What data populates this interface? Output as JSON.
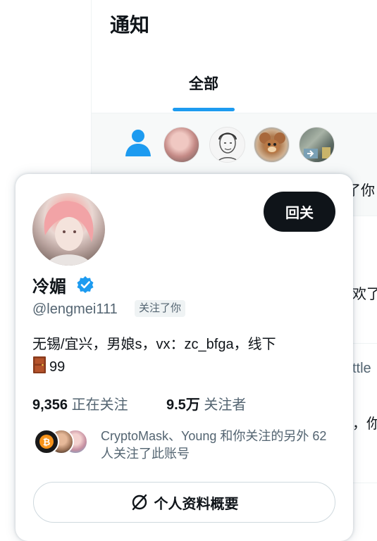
{
  "header": {
    "title": "通知"
  },
  "tabs": [
    {
      "label": "全部",
      "active": true
    }
  ],
  "notification": {
    "icon": "person-icon",
    "avatars": [
      "avatar-pink-hair",
      "avatar-sketch-man",
      "avatar-jerry-mouse",
      "avatar-photo"
    ]
  },
  "background_peek": {
    "line1": "了你",
    "line2": "欢了",
    "line3": "ttle",
    "line4": "，你"
  },
  "hover_card": {
    "follow_back_label": "回关",
    "display_name": "冷媚",
    "verified": true,
    "handle": "@lengmei111",
    "follows_you_label": "关注了你",
    "bio_line1": "无锡/宜兴，男娘s，vx：zc_bfga，线下",
    "bio_line2": "99",
    "bio_emoji": "door-icon",
    "following_count": "9,356",
    "following_label": "正在关注",
    "followers_count": "9.5万",
    "followers_label": "关注者",
    "mutuals_text": "CryptoMask、Young 和你关注的另外 62 人关注了此账号",
    "profile_summary_label": "个人资料概要"
  },
  "colors": {
    "accent": "#1d9bf0",
    "primary_text": "#0f1419",
    "secondary_text": "#536471",
    "button_dark": "#0f1419",
    "border": "#cfd9de"
  }
}
